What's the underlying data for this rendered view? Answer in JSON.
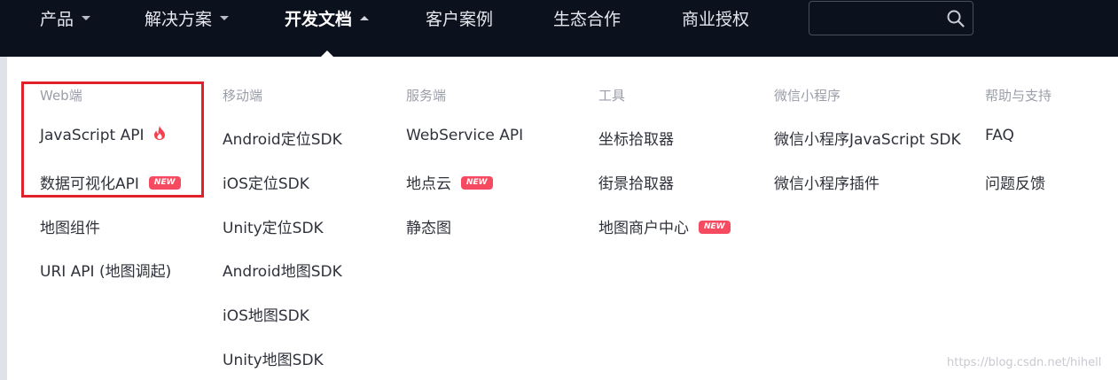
{
  "nav": {
    "items": [
      {
        "label": "产品",
        "caret": "down"
      },
      {
        "label": "解决方案",
        "caret": "down"
      },
      {
        "label": "开发文档",
        "caret": "up",
        "active": true
      },
      {
        "label": "客户案例"
      },
      {
        "label": "生态合作"
      },
      {
        "label": "商业授权"
      }
    ],
    "search": {
      "placeholder": "",
      "value": "",
      "icon": "search-icon"
    }
  },
  "dropdown": {
    "columns": [
      {
        "heading": "Web端",
        "links": [
          {
            "label": "JavaScript API",
            "icon": "fire-icon"
          },
          {
            "label": "数据可视化API",
            "badge": "NEW"
          },
          {
            "label": "地图组件"
          },
          {
            "label": "URI API (地图调起)"
          }
        ]
      },
      {
        "heading": "移动端",
        "links": [
          {
            "label": "Android定位SDK"
          },
          {
            "label": "iOS定位SDK"
          },
          {
            "label": "Unity定位SDK"
          },
          {
            "label": "Android地图SDK"
          },
          {
            "label": "iOS地图SDK"
          },
          {
            "label": "Unity地图SDK"
          }
        ]
      },
      {
        "heading": "服务端",
        "links": [
          {
            "label": "WebService API"
          },
          {
            "label": "地点云",
            "badge": "NEW"
          },
          {
            "label": "静态图"
          }
        ]
      },
      {
        "heading": "工具",
        "links": [
          {
            "label": "坐标拾取器"
          },
          {
            "label": "街景拾取器"
          },
          {
            "label": "地图商户中心",
            "badge": "NEW"
          }
        ]
      },
      {
        "heading": "微信小程序",
        "links": [
          {
            "label": "微信小程序JavaScript SDK"
          },
          {
            "label": "微信小程序插件"
          }
        ]
      },
      {
        "heading": "帮助与支持",
        "links": [
          {
            "label": "FAQ"
          },
          {
            "label": "问题反馈"
          }
        ]
      }
    ]
  },
  "annotation": {
    "highlight_color": "#e0202a"
  },
  "watermark": "https://blog.csdn.net/hihell",
  "colors": {
    "nav_bg": "#0c111e",
    "badge": "#f54a5f",
    "fire": "#f5414f"
  }
}
